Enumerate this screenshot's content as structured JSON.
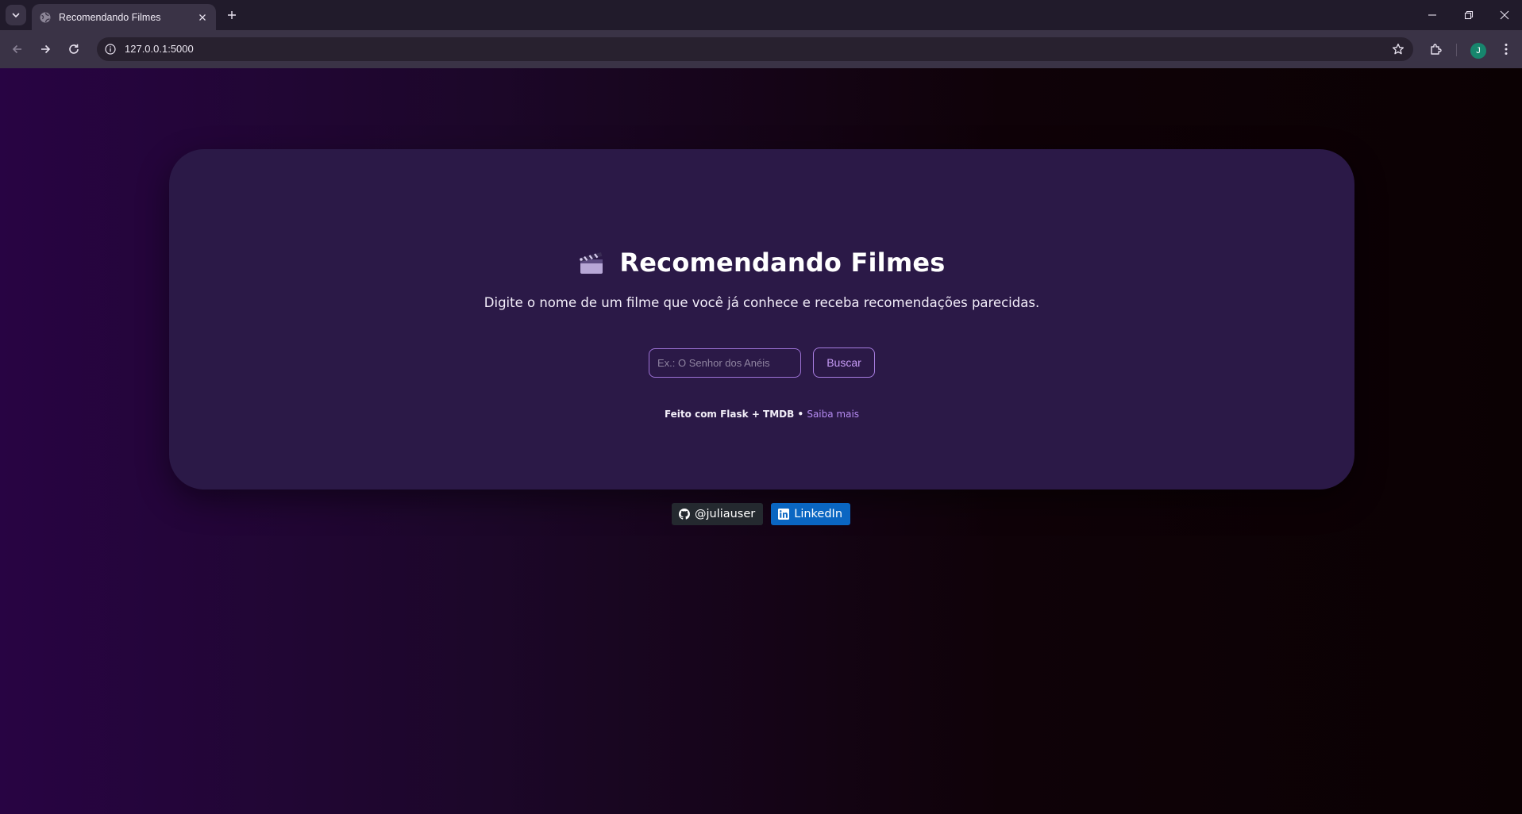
{
  "browser": {
    "tab_title": "Recomendando Filmes",
    "url": "127.0.0.1:5000",
    "profile_initial": "J"
  },
  "main": {
    "title_icon": "clapperboard-icon",
    "title": "Recomendando Filmes",
    "subtitle": "Digite o nome de um filme que você já conhece e receba recomendações parecidas.",
    "search": {
      "value": "",
      "placeholder": "Ex.: O Senhor dos Anéis",
      "button_label": "Buscar"
    },
    "footer": {
      "made_with": "Feito com Flask + TMDB •",
      "link_label": "Saiba mais"
    }
  },
  "social": {
    "github_label": "@juliauser",
    "linkedin_label": "LinkedIn"
  },
  "colors": {
    "card_bg": "#2b1947",
    "accent": "#b48af0",
    "linkedin": "#0a66c2",
    "github": "#24292f"
  }
}
